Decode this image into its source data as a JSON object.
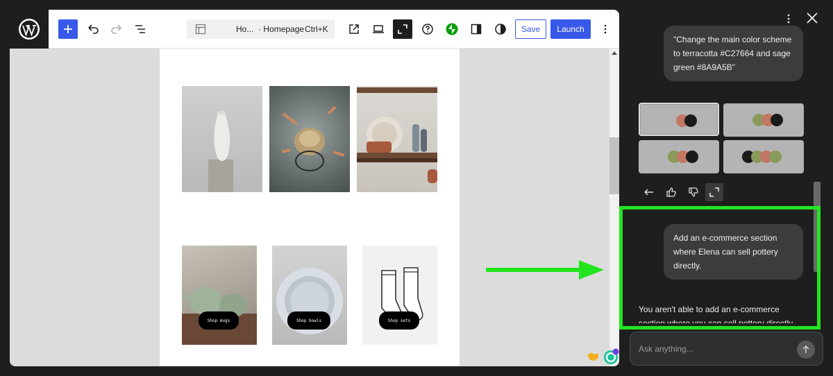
{
  "toolbar": {
    "doc_title": "Ho...",
    "doc_separator": "·",
    "doc_page": "Homepage",
    "doc_shortcut": "Ctrl+K",
    "save_label": "Save",
    "launch_label": "Launch",
    "accent_color": "#3858e9"
  },
  "canvas": {
    "shop_buttons": [
      "Shop mugs",
      "Shop bowls",
      "Shop sets"
    ]
  },
  "assistant": {
    "user_message_1": "\"Change the main color scheme to terracotta #C27664 and sage green #8A9A5B\"",
    "palettes": [
      {
        "selected": true,
        "colors": [
          "#b4b4b4",
          "#c27664",
          "#1a1a1a"
        ]
      },
      {
        "selected": false,
        "colors": [
          "#8a9a5b",
          "#c27664",
          "#1a1a1a"
        ]
      },
      {
        "selected": false,
        "colors": [
          "#8a9a5b",
          "#c27664",
          "#1a1a1a"
        ]
      },
      {
        "selected": false,
        "colors": [
          "#1a1a1a",
          "#8a9a5b",
          "#c27664",
          "#8a9a5b"
        ]
      }
    ],
    "user_message_2": "Add an e-commerce section where Elena can sell pottery directly.",
    "assistant_reply": "You aren't able to add an e-commerce section where you can sell pottery directly.",
    "input_placeholder": "Ask anything...",
    "highlight_color": "#22e51f"
  },
  "icons": [
    "wordpress-logo-icon",
    "plus-icon",
    "undo-icon",
    "redo-icon",
    "list-view-icon",
    "layout-icon",
    "external-link-icon",
    "laptop-icon",
    "fullscreen-icon",
    "help-icon",
    "jetpack-icon",
    "sidebar-icon",
    "contrast-icon",
    "more-vertical-icon",
    "close-icon",
    "reply-icon",
    "thumbs-up-icon",
    "thumbs-down-icon",
    "expand-icon",
    "send-arrow-icon",
    "grammarly-icon",
    "handshake-icon"
  ]
}
